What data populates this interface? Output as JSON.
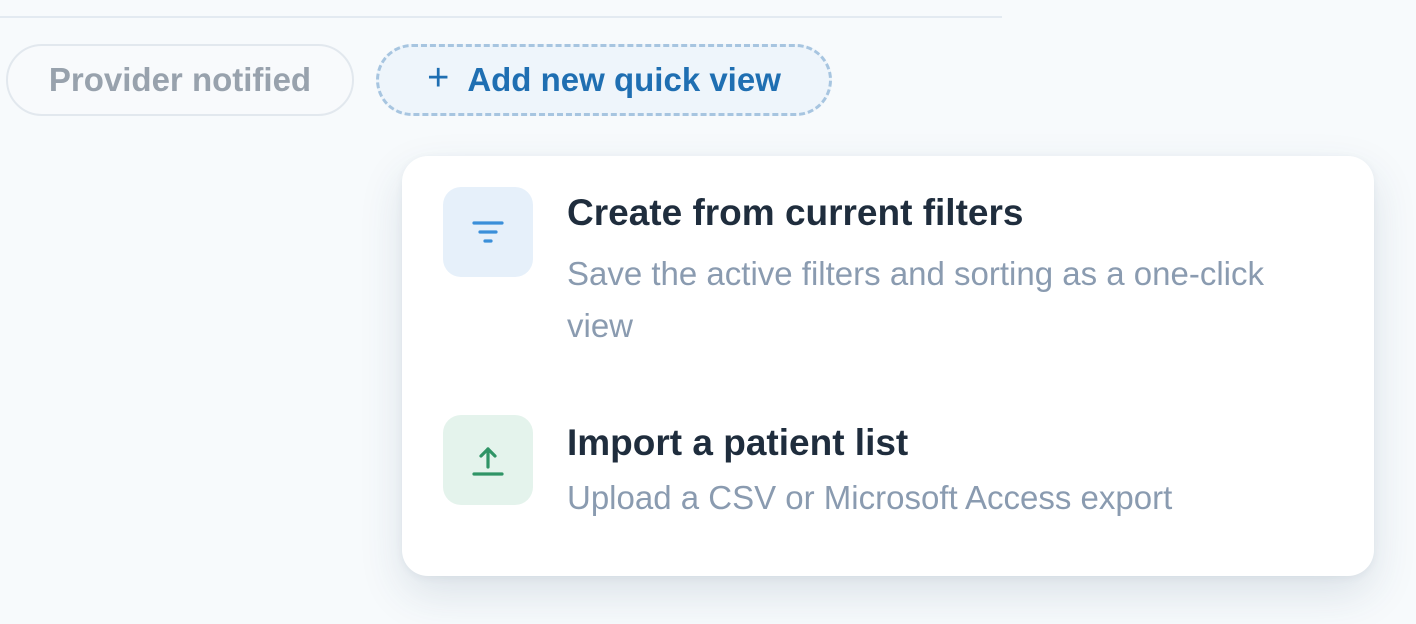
{
  "quick_views": {
    "chips": [
      {
        "label": "Provider notified"
      }
    ],
    "add_button": {
      "icon": "plus-icon",
      "icon_glyph": "+",
      "label": "Add new quick view"
    }
  },
  "add_menu": {
    "items": [
      {
        "icon": "filter-icon",
        "icon_color": "#3b8fd9",
        "title": "Create from current filters",
        "description": "Save the active filters and sorting as a one-click view"
      },
      {
        "icon": "upload-icon",
        "icon_color": "#2f9466",
        "title": "Import a patient list",
        "description": "Upload a CSV or Microsoft Access export"
      }
    ]
  },
  "colors": {
    "accent": "#1f6fb2",
    "background": "#f7fafc",
    "text_primary": "#1f2d3d",
    "text_secondary": "#8a9bb0"
  }
}
